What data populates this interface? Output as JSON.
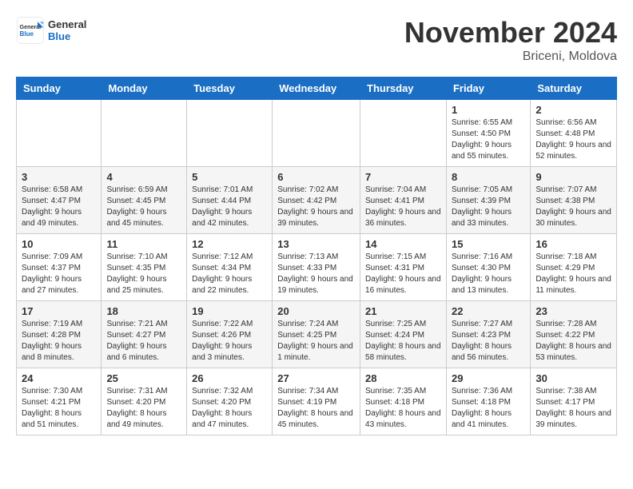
{
  "header": {
    "logo_general": "General",
    "logo_blue": "Blue",
    "month_title": "November 2024",
    "location": "Briceni, Moldova"
  },
  "weekdays": [
    "Sunday",
    "Monday",
    "Tuesday",
    "Wednesday",
    "Thursday",
    "Friday",
    "Saturday"
  ],
  "weeks": [
    [
      {
        "day": "",
        "info": ""
      },
      {
        "day": "",
        "info": ""
      },
      {
        "day": "",
        "info": ""
      },
      {
        "day": "",
        "info": ""
      },
      {
        "day": "",
        "info": ""
      },
      {
        "day": "1",
        "info": "Sunrise: 6:55 AM\nSunset: 4:50 PM\nDaylight: 9 hours and 55 minutes."
      },
      {
        "day": "2",
        "info": "Sunrise: 6:56 AM\nSunset: 4:48 PM\nDaylight: 9 hours and 52 minutes."
      }
    ],
    [
      {
        "day": "3",
        "info": "Sunrise: 6:58 AM\nSunset: 4:47 PM\nDaylight: 9 hours and 49 minutes."
      },
      {
        "day": "4",
        "info": "Sunrise: 6:59 AM\nSunset: 4:45 PM\nDaylight: 9 hours and 45 minutes."
      },
      {
        "day": "5",
        "info": "Sunrise: 7:01 AM\nSunset: 4:44 PM\nDaylight: 9 hours and 42 minutes."
      },
      {
        "day": "6",
        "info": "Sunrise: 7:02 AM\nSunset: 4:42 PM\nDaylight: 9 hours and 39 minutes."
      },
      {
        "day": "7",
        "info": "Sunrise: 7:04 AM\nSunset: 4:41 PM\nDaylight: 9 hours and 36 minutes."
      },
      {
        "day": "8",
        "info": "Sunrise: 7:05 AM\nSunset: 4:39 PM\nDaylight: 9 hours and 33 minutes."
      },
      {
        "day": "9",
        "info": "Sunrise: 7:07 AM\nSunset: 4:38 PM\nDaylight: 9 hours and 30 minutes."
      }
    ],
    [
      {
        "day": "10",
        "info": "Sunrise: 7:09 AM\nSunset: 4:37 PM\nDaylight: 9 hours and 27 minutes."
      },
      {
        "day": "11",
        "info": "Sunrise: 7:10 AM\nSunset: 4:35 PM\nDaylight: 9 hours and 25 minutes."
      },
      {
        "day": "12",
        "info": "Sunrise: 7:12 AM\nSunset: 4:34 PM\nDaylight: 9 hours and 22 minutes."
      },
      {
        "day": "13",
        "info": "Sunrise: 7:13 AM\nSunset: 4:33 PM\nDaylight: 9 hours and 19 minutes."
      },
      {
        "day": "14",
        "info": "Sunrise: 7:15 AM\nSunset: 4:31 PM\nDaylight: 9 hours and 16 minutes."
      },
      {
        "day": "15",
        "info": "Sunrise: 7:16 AM\nSunset: 4:30 PM\nDaylight: 9 hours and 13 minutes."
      },
      {
        "day": "16",
        "info": "Sunrise: 7:18 AM\nSunset: 4:29 PM\nDaylight: 9 hours and 11 minutes."
      }
    ],
    [
      {
        "day": "17",
        "info": "Sunrise: 7:19 AM\nSunset: 4:28 PM\nDaylight: 9 hours and 8 minutes."
      },
      {
        "day": "18",
        "info": "Sunrise: 7:21 AM\nSunset: 4:27 PM\nDaylight: 9 hours and 6 minutes."
      },
      {
        "day": "19",
        "info": "Sunrise: 7:22 AM\nSunset: 4:26 PM\nDaylight: 9 hours and 3 minutes."
      },
      {
        "day": "20",
        "info": "Sunrise: 7:24 AM\nSunset: 4:25 PM\nDaylight: 9 hours and 1 minute."
      },
      {
        "day": "21",
        "info": "Sunrise: 7:25 AM\nSunset: 4:24 PM\nDaylight: 8 hours and 58 minutes."
      },
      {
        "day": "22",
        "info": "Sunrise: 7:27 AM\nSunset: 4:23 PM\nDaylight: 8 hours and 56 minutes."
      },
      {
        "day": "23",
        "info": "Sunrise: 7:28 AM\nSunset: 4:22 PM\nDaylight: 8 hours and 53 minutes."
      }
    ],
    [
      {
        "day": "24",
        "info": "Sunrise: 7:30 AM\nSunset: 4:21 PM\nDaylight: 8 hours and 51 minutes."
      },
      {
        "day": "25",
        "info": "Sunrise: 7:31 AM\nSunset: 4:20 PM\nDaylight: 8 hours and 49 minutes."
      },
      {
        "day": "26",
        "info": "Sunrise: 7:32 AM\nSunset: 4:20 PM\nDaylight: 8 hours and 47 minutes."
      },
      {
        "day": "27",
        "info": "Sunrise: 7:34 AM\nSunset: 4:19 PM\nDaylight: 8 hours and 45 minutes."
      },
      {
        "day": "28",
        "info": "Sunrise: 7:35 AM\nSunset: 4:18 PM\nDaylight: 8 hours and 43 minutes."
      },
      {
        "day": "29",
        "info": "Sunrise: 7:36 AM\nSunset: 4:18 PM\nDaylight: 8 hours and 41 minutes."
      },
      {
        "day": "30",
        "info": "Sunrise: 7:38 AM\nSunset: 4:17 PM\nDaylight: 8 hours and 39 minutes."
      }
    ]
  ]
}
